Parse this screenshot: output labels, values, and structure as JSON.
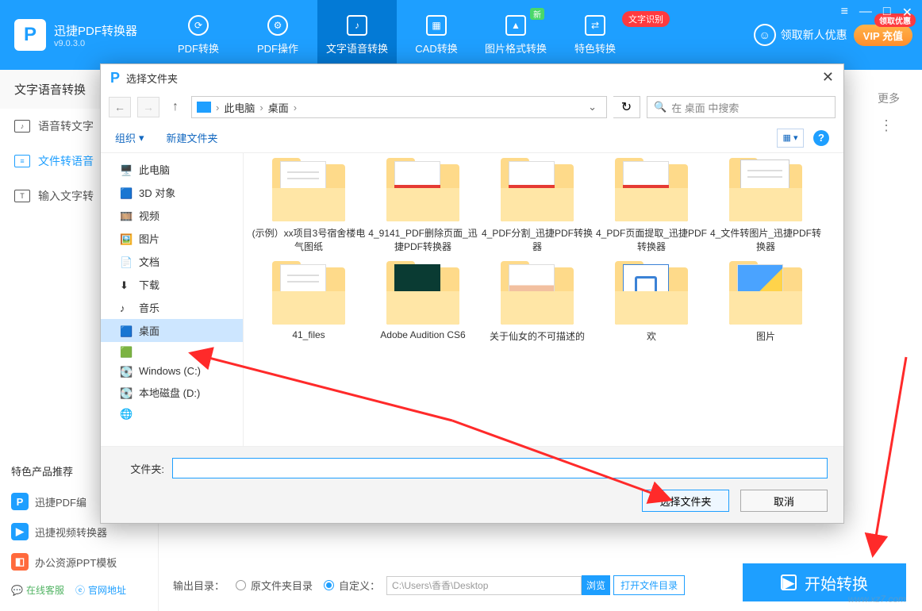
{
  "app": {
    "name": "迅捷PDF转换器",
    "version": "v9.0.3.0"
  },
  "header": {
    "tabs": [
      {
        "label": "PDF转换"
      },
      {
        "label": "PDF操作"
      },
      {
        "label": "文字语音转换"
      },
      {
        "label": "CAD转换"
      },
      {
        "label": "图片格式转换"
      },
      {
        "label": "特色转换"
      }
    ],
    "badge_new": "新",
    "text_recognition": "文字识别",
    "get_newcomer": "领取新人优惠",
    "vip_label": "VIP 充值",
    "vip_bubble": "领取优惠"
  },
  "win": {
    "menu": "≡",
    "min": "—",
    "max": "□",
    "close": "✕"
  },
  "sidebar": {
    "title": "文字语音转换",
    "items": [
      {
        "label": "语音转文字"
      },
      {
        "label": "文件转语音"
      },
      {
        "label": "输入文字转"
      }
    ]
  },
  "main": {
    "more": "更多",
    "dots": "⋮"
  },
  "promos": {
    "hd": "特色产品推荐",
    "items": [
      {
        "label": "迅捷PDF编",
        "color": "#1E9FFF",
        "glyph": "P"
      },
      {
        "label": "迅捷视频转换器",
        "color": "#1E9FFF",
        "glyph": "▶"
      },
      {
        "label": "办公资源PPT模板",
        "color": "#ff6a3d",
        "glyph": "◧"
      }
    ],
    "footer": {
      "cs": "在线客服",
      "site": "官网地址"
    }
  },
  "output": {
    "label": "输出目录：",
    "opt1": "原文件夹目录",
    "opt2": "自定义：",
    "path": "C:\\Users\\香香\\Desktop",
    "browse": "浏览",
    "open": "打开文件目录",
    "start": "开始转换"
  },
  "dialog": {
    "title": "选择文件夹",
    "breadcrumb": {
      "root": "此电脑",
      "leaf": "桌面"
    },
    "search_placeholder": "在 桌面 中搜索",
    "toolbar": {
      "org": "组织",
      "newf": "新建文件夹"
    },
    "tree": [
      {
        "label": "此电脑",
        "ico": "pc"
      },
      {
        "label": "3D 对象",
        "ico": "3d"
      },
      {
        "label": "视频",
        "ico": "vid"
      },
      {
        "label": "图片",
        "ico": "img"
      },
      {
        "label": "文档",
        "ico": "doc"
      },
      {
        "label": "下载",
        "ico": "dl"
      },
      {
        "label": "音乐",
        "ico": "mus"
      },
      {
        "label": "桌面",
        "ico": "desk",
        "sel": true
      },
      {
        "label": "",
        "ico": "iqy"
      },
      {
        "label": "Windows (C:)",
        "ico": "drive"
      },
      {
        "label": "本地磁盘 (D:)",
        "ico": "drive"
      },
      {
        "label": "",
        "ico": "net"
      }
    ],
    "files_row1": [
      {
        "name": "(示例）xx项目3号宿舍楼电气图纸",
        "type": "folder-paper"
      },
      {
        "name": "4_9141_PDF删除页面_迅捷PDF转换器",
        "type": "folder-pdf"
      },
      {
        "name": "4_PDF分割_迅捷PDF转换器",
        "type": "folder-pdf"
      },
      {
        "name": "4_PDF页面提取_迅捷PDF转换器",
        "type": "folder-pdf"
      },
      {
        "name": "4_文件转图片_迅捷PDF转换器",
        "type": "folder-thumb"
      }
    ],
    "files_row2": [
      {
        "name": "41_files",
        "type": "folder-paper"
      },
      {
        "name": "Adobe Audition CS6",
        "type": "folder-au"
      },
      {
        "name": "关于仙女的不可描述的",
        "type": "folder-photo"
      },
      {
        "name": "欢",
        "type": "folder-doc"
      },
      {
        "name": "图片",
        "type": "folder-imgs"
      }
    ],
    "footer": {
      "folder_label": "文件夹:",
      "ok": "选择文件夹",
      "cancel": "取消"
    }
  },
  "watermark": "www.xz7.com"
}
